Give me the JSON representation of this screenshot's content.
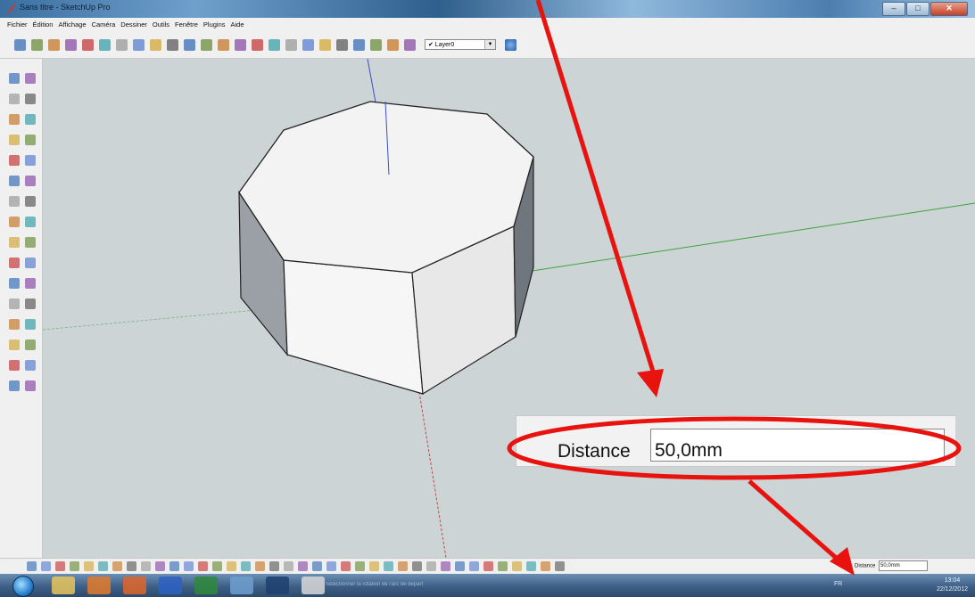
{
  "window": {
    "title": "Sans titre - SketchUp Pro",
    "controls": [
      "minimize-icon",
      "maximize-icon",
      "close-icon"
    ]
  },
  "menu": [
    "Fichier",
    "Édition",
    "Affichage",
    "Caméra",
    "Dessiner",
    "Outils",
    "Fenêtre",
    "Plugins",
    "Aide"
  ],
  "toolbar": {
    "layer_select": "✔ Layer0",
    "icons": [
      "new-icon",
      "open-icon",
      "save-icon",
      "cut-icon",
      "copy-icon",
      "paste-icon",
      "erase-icon",
      "undo-icon",
      "redo-icon",
      "print-icon",
      "model-info-icon",
      "iso-view-icon",
      "top-view-icon",
      "front-view-icon",
      "right-view-icon",
      "back-view-icon",
      "left-view-icon",
      "xray-icon",
      "wireframe-icon",
      "hidden-line-icon",
      "shaded-icon",
      "textured-icon",
      "monochrome-icon",
      "layer-manager-icon"
    ]
  },
  "left_tools": [
    "select-icon",
    "component-icon",
    "paint-icon",
    "eraser-icon",
    "rectangle-icon",
    "line-icon",
    "circle-icon",
    "arc-icon",
    "polygon-icon",
    "freehand-icon",
    "move-icon",
    "pushpull-icon",
    "rotate-icon",
    "followme-icon",
    "scale-icon",
    "offset-icon",
    "tape-icon",
    "dimension-icon",
    "protractor-icon",
    "text-icon",
    "axes-icon",
    "3dtext-icon",
    "orbit-icon",
    "pan-icon",
    "zoom-icon",
    "zoom-window-icon",
    "zoom-extents-icon",
    "previous-view-icon",
    "position-camera-icon",
    "look-around-icon",
    "walk-icon",
    "section-icon"
  ],
  "callout": {
    "label": "Distance",
    "value": "50,0mm"
  },
  "status": {
    "vcb_label": "Distance",
    "vcb_value": "50,0mm",
    "hint": "Sélectionner la rotation de l'arc de départ"
  },
  "taskbar": {
    "apps": [
      "explorer-icon",
      "media-player-icon",
      "firefox-icon",
      "word-icon",
      "excel-icon",
      "paint-icon",
      "sketchup-icon",
      "pencil-icon"
    ],
    "lang": "FR",
    "time": "13:04",
    "date": "22/12/2012"
  },
  "colors": {
    "annotation_red": "#e8130f",
    "viewport_bg": "#ccd4d5",
    "blue_axis": "#3a4dcc",
    "green_axis": "#3ea33e",
    "red_axis": "#c44848"
  }
}
